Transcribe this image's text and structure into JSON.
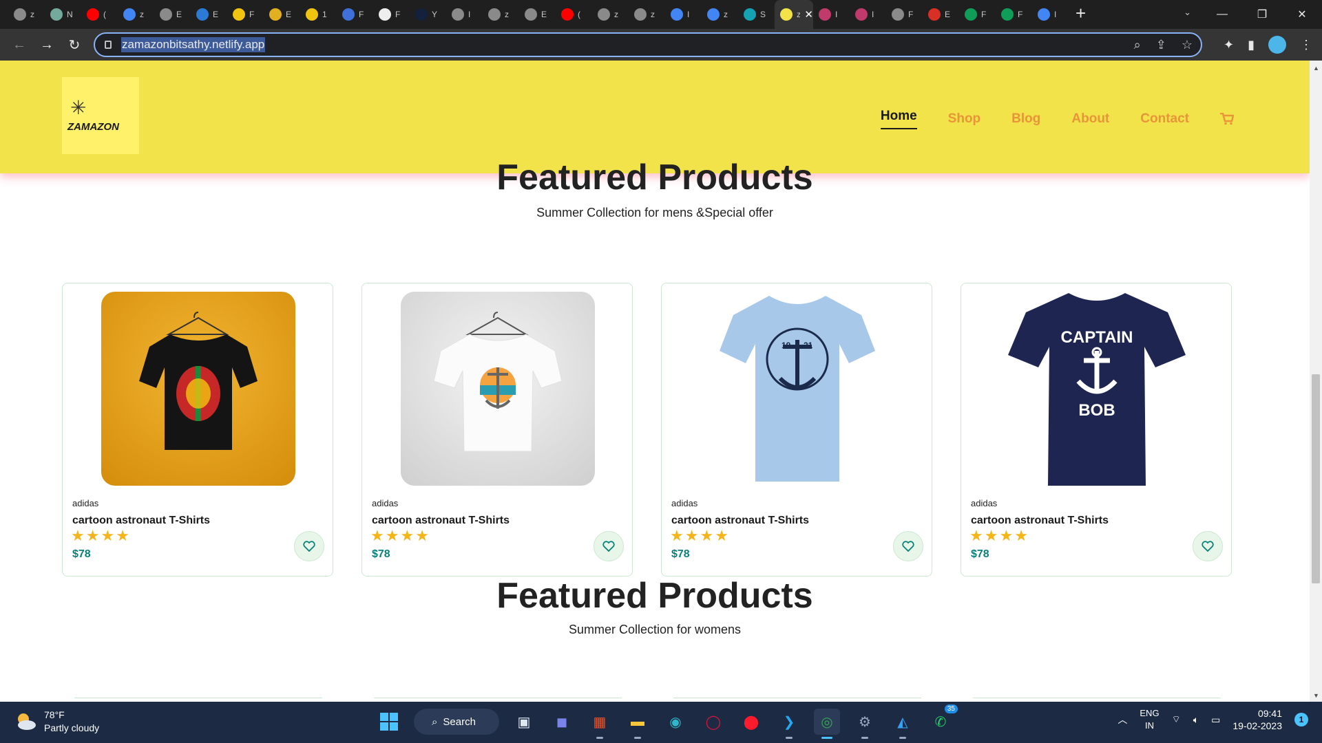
{
  "browser": {
    "tabs": [
      {
        "title": "z",
        "color": "#8a8a8a"
      },
      {
        "title": "N",
        "color": "#74aa9c"
      },
      {
        "title": "(",
        "color": "#ff0000"
      },
      {
        "title": "z",
        "color": "#4285f4"
      },
      {
        "title": "E",
        "color": "#8a8a8a"
      },
      {
        "title": "E",
        "color": "#2b7bd6"
      },
      {
        "title": "F",
        "color": "#f1c40f"
      },
      {
        "title": "E",
        "color": "#e0b020"
      },
      {
        "title": "1",
        "color": "#f1c40f"
      },
      {
        "title": "F",
        "color": "#3f6fd8"
      },
      {
        "title": "F",
        "color": "#eeeeee"
      },
      {
        "title": "Y",
        "color": "#14213d"
      },
      {
        "title": "I",
        "color": "#8a8a8a"
      },
      {
        "title": "z",
        "color": "#8a8a8a"
      },
      {
        "title": "E",
        "color": "#8a8a8a"
      },
      {
        "title": "(",
        "color": "#ff0000"
      },
      {
        "title": "z",
        "color": "#8a8a8a"
      },
      {
        "title": "z",
        "color": "#8a8a8a"
      },
      {
        "title": "I",
        "color": "#4285f4"
      },
      {
        "title": "z",
        "color": "#4285f4"
      },
      {
        "title": "S",
        "color": "#15a3b3"
      }
    ],
    "active_tab": {
      "title": "z",
      "color": "#f3e34a"
    },
    "tabs_after": [
      {
        "title": "I",
        "color": "#c03a6b"
      },
      {
        "title": "I",
        "color": "#c03a6b"
      },
      {
        "title": "F",
        "color": "#8a8a8a"
      },
      {
        "title": "E",
        "color": "#d93025"
      },
      {
        "title": "F",
        "color": "#0f9d58"
      },
      {
        "title": "F",
        "color": "#0f9d58"
      },
      {
        "title": "I",
        "color": "#4285f4"
      }
    ],
    "url": "zamazonbitsathy.netlify.app"
  },
  "site": {
    "logo_text": "ZAMAZON",
    "nav": [
      {
        "label": "Home",
        "active": true
      },
      {
        "label": "Shop",
        "active": false
      },
      {
        "label": "Blog",
        "active": false
      },
      {
        "label": "About",
        "active": false
      },
      {
        "label": "Contact",
        "active": false
      }
    ],
    "cart_icon": "shopping-cart-icon",
    "colors": {
      "header_bg": "#f3e34a",
      "accent": "#e8953a",
      "price": "#088178",
      "stars": "#f3b519"
    }
  },
  "featured": {
    "title": "Featured Products",
    "subtitle": "Summer Collection for mens &Special offer",
    "products": [
      {
        "brand": "adidas",
        "name": "cartoon astronaut T-Shirts",
        "rating": 4,
        "price": "$78",
        "image": "black-kathakali-tshirt"
      },
      {
        "brand": "adidas",
        "name": "cartoon astronaut T-Shirts",
        "rating": 4,
        "price": "$78",
        "image": "white-anchor-tshirt"
      },
      {
        "brand": "adidas",
        "name": "cartoon astronaut T-Shirts",
        "rating": 4,
        "price": "$78",
        "image": "lightblue-ship-tshirt"
      },
      {
        "brand": "adidas",
        "name": "cartoon astronaut T-Shirts",
        "rating": 4,
        "price": "$78",
        "image": "navy-captain-bob-tshirt"
      }
    ],
    "shirt_print": {
      "line1": "CAPTAIN",
      "line2": "BOB",
      "year_left": "19",
      "year_right": "21"
    }
  },
  "featured_women": {
    "title": "Featured Products",
    "subtitle": "Summer Collection for womens"
  },
  "taskbar": {
    "temperature": "78°F",
    "weather": "Partly cloudy",
    "search_label": "Search",
    "whatsapp_badge": "35",
    "lang_top": "ENG",
    "lang_bottom": "IN",
    "time": "09:41",
    "date": "19-02-2023",
    "notifications": "1"
  }
}
